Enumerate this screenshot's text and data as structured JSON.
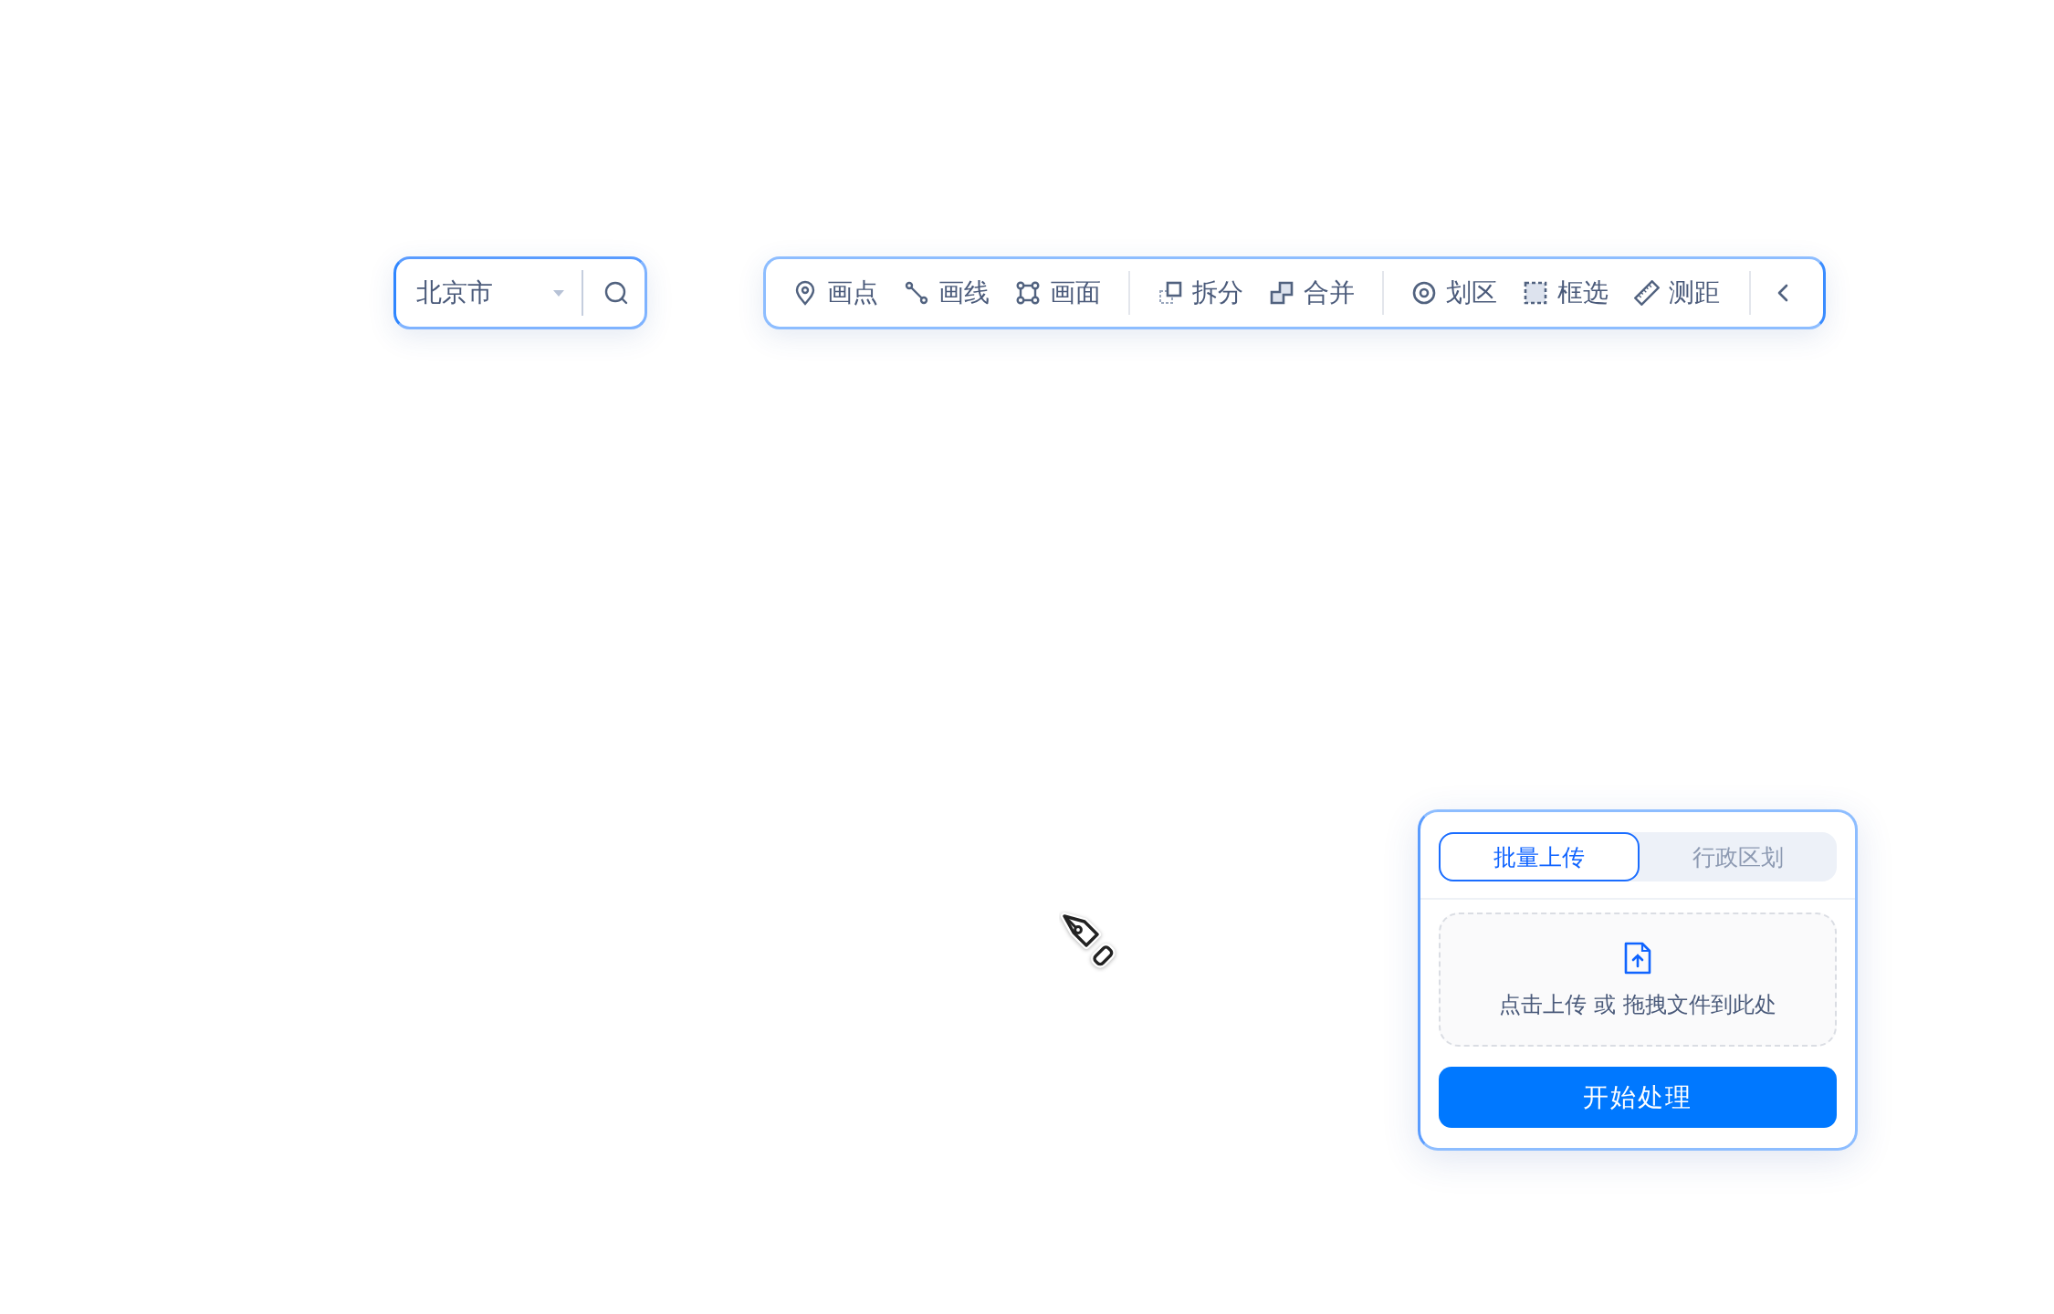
{
  "city_select": {
    "value": "北京市"
  },
  "toolbar": {
    "groups": [
      {
        "tools": [
          {
            "kind": "point",
            "label": "画点"
          },
          {
            "kind": "line",
            "label": "画线"
          },
          {
            "kind": "polygon",
            "label": "画面"
          }
        ]
      },
      {
        "tools": [
          {
            "kind": "split",
            "label": "拆分"
          },
          {
            "kind": "merge",
            "label": "合并"
          }
        ]
      },
      {
        "tools": [
          {
            "kind": "zone",
            "label": "划区"
          },
          {
            "kind": "select",
            "label": "框选"
          },
          {
            "kind": "measure",
            "label": "测距"
          }
        ]
      }
    ]
  },
  "upload_panel": {
    "tabs": [
      {
        "label": "批量上传",
        "selected": true
      },
      {
        "label": "行政区划",
        "selected": false
      }
    ],
    "dropzone": {
      "text": "点击上传 或 拖拽文件到此处"
    },
    "button": "开始处理"
  }
}
